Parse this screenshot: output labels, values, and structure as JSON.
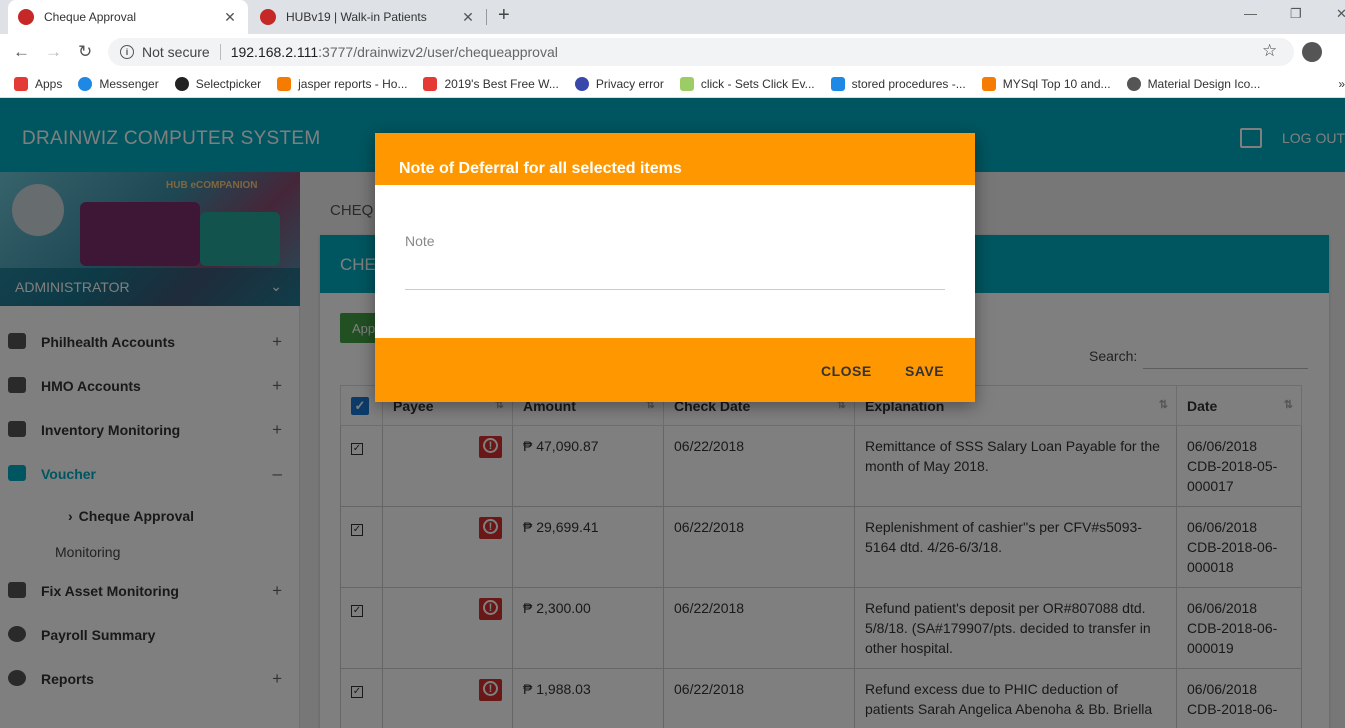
{
  "browser": {
    "tabs": [
      {
        "title": "Cheque Approval",
        "active": true,
        "favicon_color": "#c62828"
      },
      {
        "title": "HUBv19 | Walk-in Patients",
        "active": false,
        "favicon_color": "#c62828"
      }
    ],
    "new_tab": "+",
    "window": {
      "minimize": "—",
      "restore": "❐",
      "close": "✕"
    },
    "nav": {
      "back": "←",
      "forward": "→",
      "reload": "↻"
    },
    "address": {
      "security": "Not secure",
      "host": "192.168.2.111",
      "path": ":3777/drainwizv2/user/chequeapproval"
    },
    "bookmarks": [
      {
        "label": "Apps",
        "color": "#e53935"
      },
      {
        "label": "Messenger",
        "color": "#1e88e5"
      },
      {
        "label": "Selectpicker",
        "color": "#222222"
      },
      {
        "label": "jasper reports - Ho...",
        "color": "#f57c00"
      },
      {
        "label": "2019's Best Free W...",
        "color": "#e53935"
      },
      {
        "label": "Privacy error",
        "color": "#3949ab"
      },
      {
        "label": "click - Sets Click Ev...",
        "color": "#9ccc65"
      },
      {
        "label": "stored procedures -...",
        "color": "#1e88e5"
      },
      {
        "label": "MYSql Top 10 and...",
        "color": "#f57c00"
      },
      {
        "label": "Material Design Ico...",
        "color": "#555555"
      }
    ],
    "bookmarks_more": "»"
  },
  "app": {
    "brand": "DRAINWIZ COMPUTER SYSTEM",
    "logout": "LOG OUT",
    "accent": "#00acc1",
    "sidebar": {
      "hub_label": "HUB eCOMPANION",
      "user": "ADMINISTRATOR",
      "items": [
        {
          "label": "Philhealth Accounts",
          "expand": "+",
          "active": false
        },
        {
          "label": "HMO Accounts",
          "expand": "+",
          "active": false
        },
        {
          "label": "Inventory Monitoring",
          "expand": "+",
          "active": false
        },
        {
          "label": "Voucher",
          "expand": "–",
          "active": true
        }
      ],
      "voucher_sub": {
        "label": "Cheque Approval",
        "arrow": "›"
      },
      "voucher_sub2": "Monitoring",
      "items_after": [
        {
          "label": "Fix Asset Monitoring",
          "expand": "+"
        },
        {
          "label": "Payroll Summary",
          "expand": ""
        },
        {
          "label": "Reports",
          "expand": "+"
        }
      ]
    },
    "content": {
      "breadcrumb": "CHEQ",
      "card_title": "CHE",
      "approve_button": "App",
      "search_label": "Search:",
      "columns": [
        "Payee",
        "Amount",
        "Check Date",
        "Explanation",
        "Date"
      ],
      "rows": [
        {
          "amount": "₱ 47,090.87",
          "check_date": "06/22/2018",
          "explanation": "Remittance of SSS Salary Loan Payable for the month of May 2018.",
          "date": "06/06/2018 CDB-2018-05-000017"
        },
        {
          "amount": "₱ 29,699.41",
          "check_date": "06/22/2018",
          "explanation": "Replenishment of cashier''s per CFV#s5093-5164 dtd. 4/26-6/3/18.",
          "date": "06/06/2018 CDB-2018-06-000018"
        },
        {
          "amount": "₱ 2,300.00",
          "check_date": "06/22/2018",
          "explanation": "Refund patient's deposit per OR#807088 dtd. 5/8/18. (SA#179907/pts. decided to transfer in other hospital.",
          "date": "06/06/2018 CDB-2018-06-000019"
        },
        {
          "amount": "₱ 1,988.03",
          "check_date": "06/22/2018",
          "explanation": "Refund excess due to PHIC deduction of patients Sarah Angelica Abenoha & Bb. Briella",
          "date": "06/06/2018 CDB-2018-06-"
        }
      ]
    },
    "modal": {
      "title": "Note of Deferral for all selected items",
      "note_placeholder": "Note",
      "close_button": "CLOSE",
      "save_button": "SAVE",
      "color": "#ff9800"
    }
  }
}
